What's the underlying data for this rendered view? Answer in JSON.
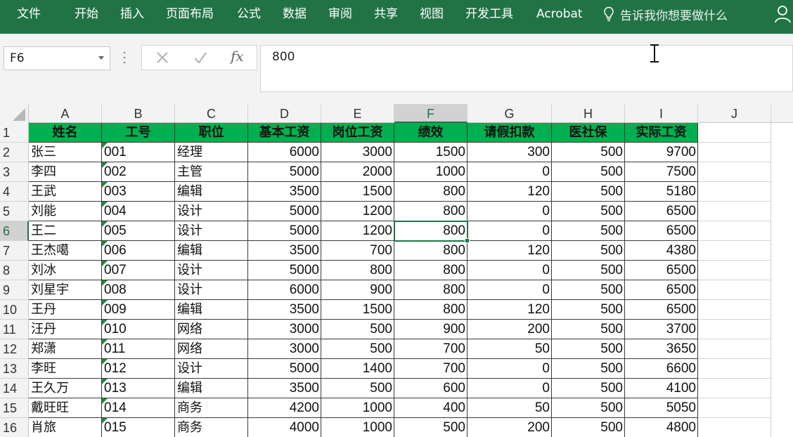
{
  "menu": {
    "items": [
      "文件",
      "开始",
      "插入",
      "页面布局",
      "公式",
      "数据",
      "审阅",
      "共享",
      "视图",
      "开发工具",
      "Acrobat"
    ],
    "tell_me": "告诉我你想要做什么",
    "tell_me_icon": "lightbulb-icon",
    "user_icon": "user-icon"
  },
  "formula_bar": {
    "name_box": "F6",
    "fx_label": "fx",
    "value": "800"
  },
  "colors": {
    "ribbon": "#217346",
    "header_fill": "#00b050"
  },
  "sheet": {
    "column_letters": [
      "A",
      "B",
      "C",
      "D",
      "E",
      "F",
      "G",
      "H",
      "I",
      "J"
    ],
    "row_numbers": [
      "1",
      "2",
      "3",
      "4",
      "5",
      "6",
      "7",
      "8",
      "9",
      "10",
      "11",
      "12",
      "13",
      "14",
      "15",
      "16"
    ],
    "selected_cell": "F6",
    "table_headers": [
      "姓名",
      "工号",
      "职位",
      "基本工资",
      "岗位工资",
      "绩效",
      "请假扣款",
      "医社保",
      "实际工资"
    ],
    "rows": [
      [
        "张三",
        "001",
        "经理",
        "6000",
        "3000",
        "1500",
        "300",
        "500",
        "9700"
      ],
      [
        "李四",
        "002",
        "主管",
        "5000",
        "2000",
        "1000",
        "0",
        "500",
        "7500"
      ],
      [
        "王武",
        "003",
        "编辑",
        "3500",
        "1500",
        "800",
        "120",
        "500",
        "5180"
      ],
      [
        "刘能",
        "004",
        "设计",
        "5000",
        "1200",
        "800",
        "0",
        "500",
        "6500"
      ],
      [
        "王二",
        "005",
        "设计",
        "5000",
        "1200",
        "800",
        "0",
        "500",
        "6500"
      ],
      [
        "王杰噶",
        "006",
        "编辑",
        "3500",
        "700",
        "800",
        "120",
        "500",
        "4380"
      ],
      [
        "刘冰",
        "007",
        "设计",
        "5000",
        "800",
        "800",
        "0",
        "500",
        "6500"
      ],
      [
        "刘星宇",
        "008",
        "设计",
        "6000",
        "900",
        "800",
        "0",
        "500",
        "6500"
      ],
      [
        "王丹",
        "009",
        "编辑",
        "3500",
        "1500",
        "800",
        "120",
        "500",
        "6500"
      ],
      [
        "汪丹",
        "010",
        "网络",
        "3000",
        "500",
        "900",
        "200",
        "500",
        "3700"
      ],
      [
        "郑潇",
        "011",
        "网络",
        "3000",
        "500",
        "700",
        "50",
        "500",
        "3650"
      ],
      [
        "李旺",
        "012",
        "设计",
        "5000",
        "1400",
        "700",
        "0",
        "500",
        "6600"
      ],
      [
        "王久万",
        "013",
        "编辑",
        "3500",
        "500",
        "600",
        "0",
        "500",
        "4100"
      ],
      [
        "戴旺旺",
        "014",
        "商务",
        "4200",
        "1000",
        "400",
        "50",
        "500",
        "5050"
      ],
      [
        "肖旅",
        "015",
        "商务",
        "4000",
        "1000",
        "500",
        "200",
        "500",
        "4800"
      ]
    ]
  }
}
